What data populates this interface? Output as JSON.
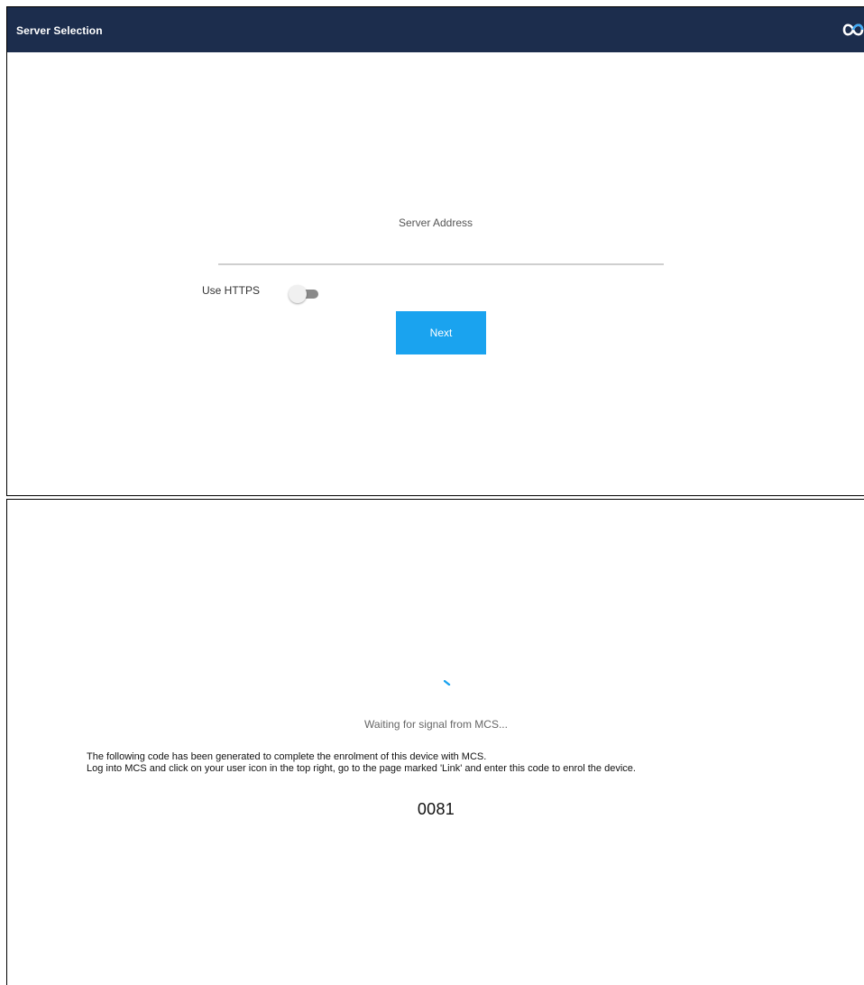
{
  "colors": {
    "appbar": "#1c2d4d",
    "primary_button": "#1aa3ef",
    "logo_stroke": "#3fa9f5"
  },
  "server_selection": {
    "title": "Server Selection",
    "logo_icon": "infinity-logo-icon",
    "server_address_label": "Server Address",
    "server_address_value": "",
    "use_https_label": "Use HTTPS",
    "use_https_enabled": false,
    "next_button_label": "Next"
  },
  "enrolment": {
    "spinner_icon": "loading-spinner-icon",
    "waiting_text": "Waiting for signal from MCS...",
    "instruction_line_1": "The following code has been generated to complete the enrolment of this device with MCS.",
    "instruction_line_2": "Log into MCS and click on your user icon in the top right, go to the page marked 'Link' and enter this code to enrol the device.",
    "code": "0081"
  }
}
